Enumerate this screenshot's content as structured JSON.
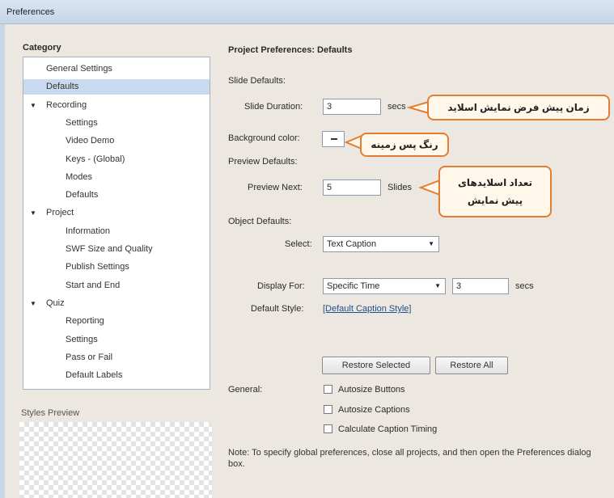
{
  "window": {
    "title": "Preferences"
  },
  "sidebar": {
    "category_label": "Category",
    "items": [
      {
        "label": "General Settings",
        "level": 1,
        "selected": false,
        "expander": false
      },
      {
        "label": "Defaults",
        "level": 1,
        "selected": true,
        "expander": false
      },
      {
        "label": "Recording",
        "level": 1,
        "selected": false,
        "expander": true
      },
      {
        "label": "Settings",
        "level": 2,
        "selected": false,
        "expander": false
      },
      {
        "label": "Video Demo",
        "level": 2,
        "selected": false,
        "expander": false
      },
      {
        "label": "Keys - (Global)",
        "level": 2,
        "selected": false,
        "expander": false
      },
      {
        "label": "Modes",
        "level": 2,
        "selected": false,
        "expander": false
      },
      {
        "label": "Defaults",
        "level": 2,
        "selected": false,
        "expander": false
      },
      {
        "label": "Project",
        "level": 1,
        "selected": false,
        "expander": true
      },
      {
        "label": "Information",
        "level": 2,
        "selected": false,
        "expander": false
      },
      {
        "label": "SWF Size and Quality",
        "level": 2,
        "selected": false,
        "expander": false
      },
      {
        "label": "Publish Settings",
        "level": 2,
        "selected": false,
        "expander": false
      },
      {
        "label": "Start and End",
        "level": 2,
        "selected": false,
        "expander": false
      },
      {
        "label": "Quiz",
        "level": 1,
        "selected": false,
        "expander": true
      },
      {
        "label": "Reporting",
        "level": 2,
        "selected": false,
        "expander": false
      },
      {
        "label": "Settings",
        "level": 2,
        "selected": false,
        "expander": false
      },
      {
        "label": "Pass or Fail",
        "level": 2,
        "selected": false,
        "expander": false
      },
      {
        "label": "Default Labels",
        "level": 2,
        "selected": false,
        "expander": false
      }
    ],
    "expander_glyph": "▼",
    "styles_preview_label": "Styles Preview"
  },
  "main": {
    "title": "Project Preferences: Defaults",
    "slide_defaults_label": "Slide Defaults:",
    "slide_duration_label": "Slide Duration:",
    "slide_duration_value": "3",
    "slide_duration_unit": "secs",
    "background_color_label": "Background color:",
    "preview_defaults_label": "Preview Defaults:",
    "preview_next_label": "Preview Next:",
    "preview_next_value": "5",
    "preview_next_unit": "Slides",
    "object_defaults_label": "Object Defaults:",
    "select_label": "Select:",
    "select_value": "Text Caption",
    "display_for_label": "Display For:",
    "display_for_value": "Specific Time",
    "display_for_time": "3",
    "display_for_unit": "secs",
    "default_style_label": "Default Style:",
    "default_style_value": "[Default Caption Style]",
    "restore_selected": "Restore Selected",
    "restore_all": "Restore All",
    "general_label": "General:",
    "autosize_buttons": "Autosize Buttons",
    "autosize_captions": "Autosize Captions",
    "calculate_caption_timing": "Calculate Caption Timing",
    "note": "Note: To specify global preferences, close all projects, and then open the Preferences dialog box.",
    "dropdown_arrow": "▼"
  },
  "annotations": {
    "slide_duration_callout": "زمان پیش فرض نمایش اسلاید",
    "background_callout": "رنگ پس زمینه",
    "preview_callout_line1": "تعداد اسلایدهای",
    "preview_callout_line2": "پیش نمایش",
    "accent_color": "#e37d33"
  }
}
